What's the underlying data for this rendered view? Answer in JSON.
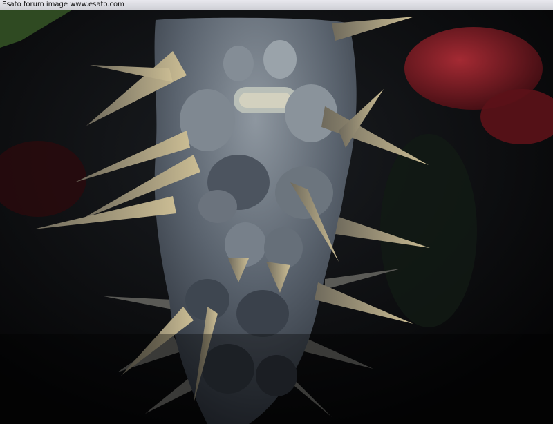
{
  "watermark": {
    "text": "Esato forum image www.esato.com"
  },
  "photo": {
    "subject": "spiny succulent stem",
    "colors": {
      "background": "#070809",
      "stem": "#5d6672",
      "stem_highlight": "#aeb6bb",
      "spine": "#8f8264",
      "spine_tip": "#c5b78d",
      "flower": "#8e1e28"
    }
  }
}
